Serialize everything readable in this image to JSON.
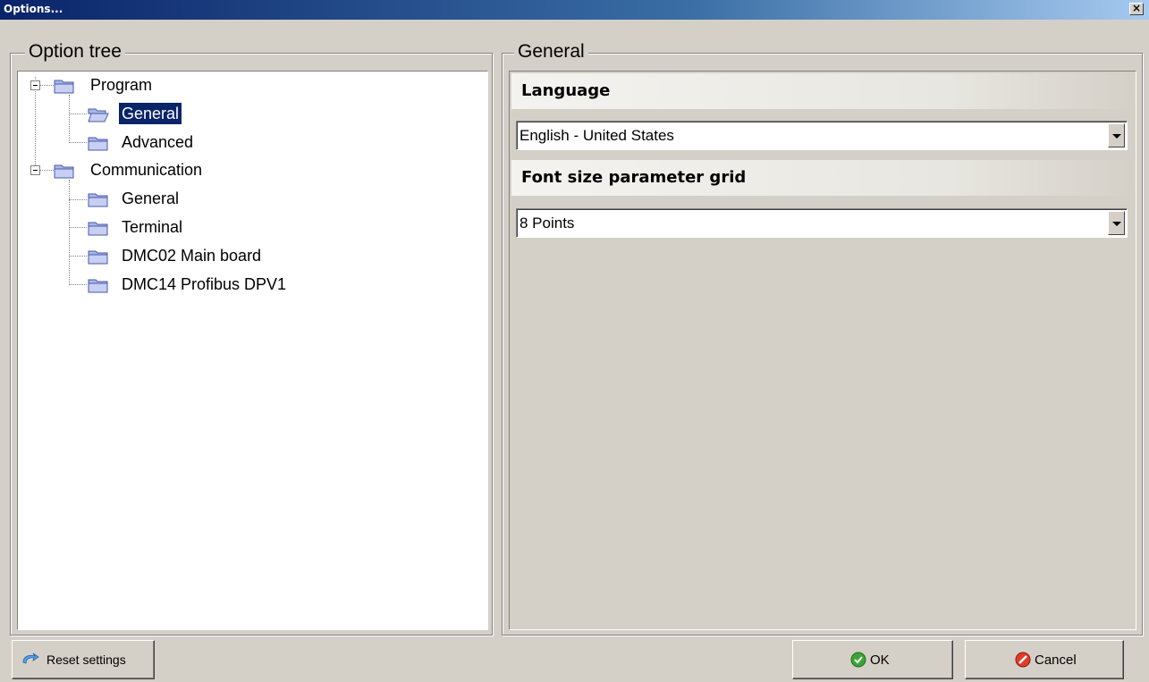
{
  "window": {
    "title": "Options...",
    "close_label": "×"
  },
  "option_tree": {
    "title": "Option tree",
    "items": [
      {
        "label": "Program",
        "icon": "folder-closed-icon"
      },
      {
        "label": "General",
        "icon": "folder-open-icon",
        "selected": true
      },
      {
        "label": "Advanced",
        "icon": "folder-closed-icon"
      },
      {
        "label": "Communication",
        "icon": "folder-closed-icon"
      },
      {
        "label": "General",
        "icon": "folder-closed-icon"
      },
      {
        "label": "Terminal",
        "icon": "folder-closed-icon"
      },
      {
        "label": "DMC02 Main board",
        "icon": "folder-closed-icon"
      },
      {
        "label": "DMC14 Profibus DPV1",
        "icon": "folder-closed-icon"
      }
    ]
  },
  "general": {
    "title": "General",
    "language": {
      "label": "Language",
      "value": "English - United States"
    },
    "font_size": {
      "label": "Font size parameter grid",
      "value": "8 Points"
    }
  },
  "buttons": {
    "reset": "Reset settings",
    "ok": "OK",
    "cancel": "Cancel"
  },
  "colors": {
    "selection": "#0a246a",
    "dialog_bg": "#d4d0c8",
    "title_start": "#0a246a",
    "title_end": "#a6caf0"
  }
}
